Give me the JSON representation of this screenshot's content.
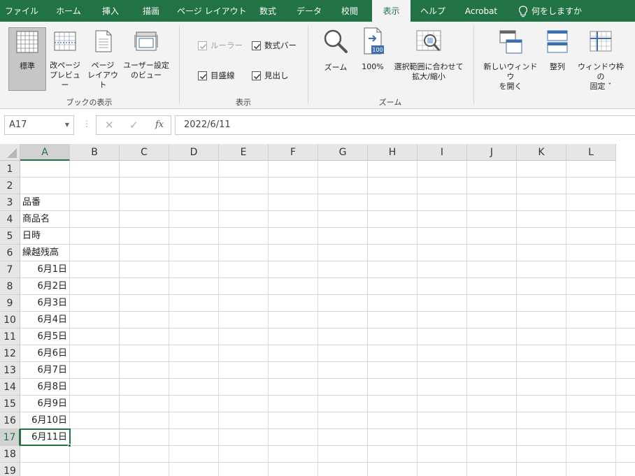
{
  "tabs": [
    "ファイル",
    "ホーム",
    "挿入",
    "描画",
    "ページ レイアウト",
    "数式",
    "データ",
    "校閲",
    "表示",
    "ヘルプ",
    "Acrobat"
  ],
  "active_tab": "表示",
  "tell_me": "何をしますか",
  "ribbon": {
    "workbook_views": {
      "normal": "標準",
      "page_break_l1": "改ページ",
      "page_break_l2": "プレビュー",
      "page_layout_l1": "ページ",
      "page_layout_l2": "レイアウト",
      "custom_l1": "ユーザー設定",
      "custom_l2": "のビュー",
      "group_label": "ブックの表示"
    },
    "show": {
      "ruler": "ルーラー",
      "formula_bar": "数式バー",
      "gridlines": "目盛線",
      "headings": "見出し",
      "group_label": "表示"
    },
    "zoom": {
      "zoom": "ズーム",
      "hundred": "100%",
      "zoom_icon_text": "100",
      "to_selection_l1": "選択範囲に合わせて",
      "to_selection_l2": "拡大/縮小",
      "group_label": "ズーム"
    },
    "window": {
      "new_window_l1": "新しいウィンドウ",
      "new_window_l2": "を開く",
      "arrange": "整列",
      "freeze_l1": "ウィンドウ枠の",
      "freeze_l2": "固定 ˇ"
    }
  },
  "formula_bar": {
    "name_box": "A17",
    "formula": "2022/6/11",
    "fx": "fx"
  },
  "columns": [
    "A",
    "B",
    "C",
    "D",
    "E",
    "F",
    "G",
    "H",
    "I",
    "J",
    "K",
    "L"
  ],
  "rows": [
    "1",
    "2",
    "3",
    "4",
    "5",
    "6",
    "7",
    "8",
    "9",
    "10",
    "11",
    "12",
    "13",
    "14",
    "15",
    "16",
    "17",
    "18",
    "19"
  ],
  "cells_a": [
    {
      "row": 3,
      "text": "品番",
      "align": "left"
    },
    {
      "row": 4,
      "text": "商品名",
      "align": "left"
    },
    {
      "row": 5,
      "text": "日時",
      "align": "left"
    },
    {
      "row": 6,
      "text": "繰越残高",
      "align": "left"
    },
    {
      "row": 7,
      "text": "6月1日",
      "align": "right"
    },
    {
      "row": 8,
      "text": "6月2日",
      "align": "right"
    },
    {
      "row": 9,
      "text": "6月3日",
      "align": "right"
    },
    {
      "row": 10,
      "text": "6月4日",
      "align": "right"
    },
    {
      "row": 11,
      "text": "6月5日",
      "align": "right"
    },
    {
      "row": 12,
      "text": "6月6日",
      "align": "right"
    },
    {
      "row": 13,
      "text": "6月7日",
      "align": "right"
    },
    {
      "row": 14,
      "text": "6月8日",
      "align": "right"
    },
    {
      "row": 15,
      "text": "6月9日",
      "align": "right"
    },
    {
      "row": 16,
      "text": "6月10日",
      "align": "right"
    },
    {
      "row": 17,
      "text": "6月11日",
      "align": "right"
    }
  ],
  "selected_row": 17,
  "selected_col": "A",
  "colors": {
    "accent": "#217346"
  }
}
